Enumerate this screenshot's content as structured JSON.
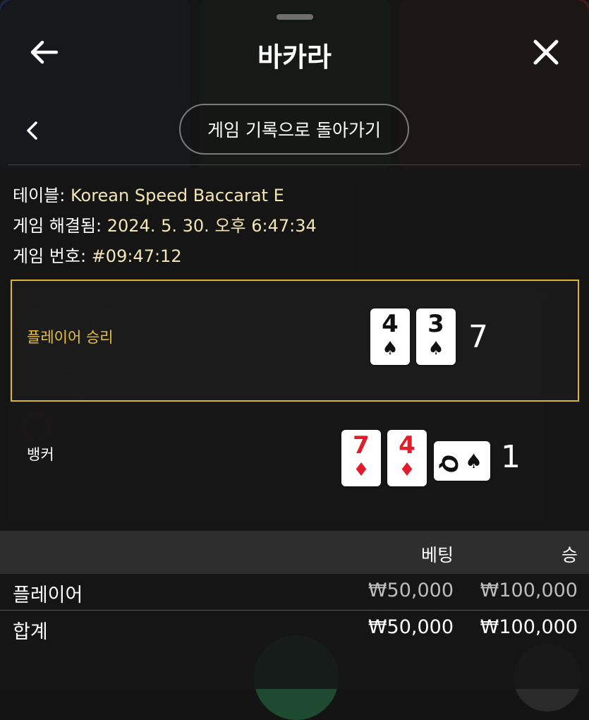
{
  "header": {
    "title": "바카라"
  },
  "return_button": {
    "label": "게임 기록으로 돌아가기"
  },
  "info": {
    "table_label": "테이블:",
    "table_value": "Korean Speed Baccarat E",
    "resolved_label": "게임 해결됨:",
    "resolved_value": "2024. 5. 30. 오후 6:47:34",
    "number_label": "게임 번호:",
    "number_value": "#09:47:12"
  },
  "player": {
    "label": "플레이어 승리",
    "cards": [
      {
        "rank": "4",
        "suit": "♠"
      },
      {
        "rank": "3",
        "suit": "♠"
      }
    ],
    "score": "7"
  },
  "banker": {
    "label": "뱅커",
    "cards": [
      {
        "rank": "7",
        "suit": "♦"
      },
      {
        "rank": "4",
        "suit": "♦"
      }
    ],
    "side_card": {
      "rank": "Q",
      "suit": "♠"
    },
    "score": "1"
  },
  "bets": {
    "col_bet": "베팅",
    "col_win": "승",
    "rows": [
      {
        "name": "플레이어",
        "bet": "₩50,000",
        "win": "₩100,000"
      }
    ],
    "total": {
      "name": "합계",
      "bet": "₩50,000",
      "win": "₩100,000"
    }
  },
  "colors": {
    "accent": "#d8b631",
    "info_value": "#f3e6b4",
    "red_suit": "#e11d2b"
  }
}
